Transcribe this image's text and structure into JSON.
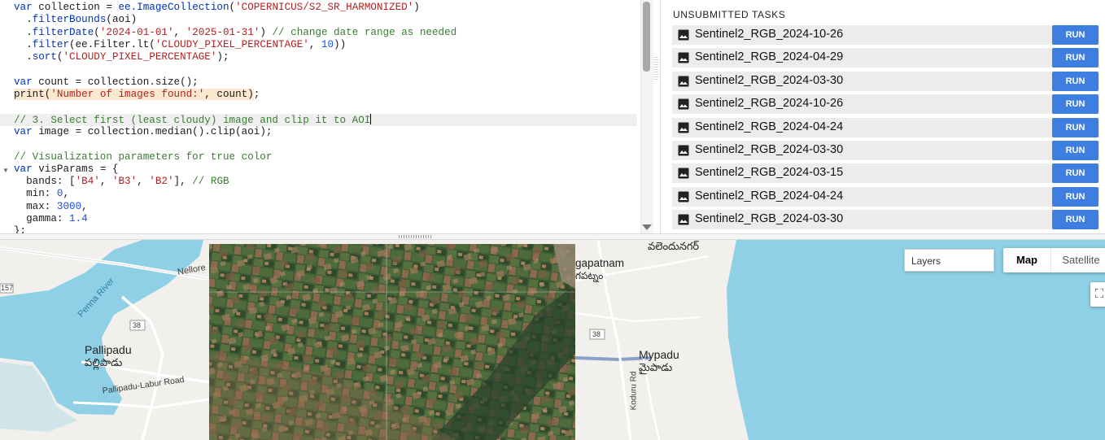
{
  "editor": {
    "lines": [
      [
        [
          "kw",
          "var"
        ],
        [
          "t",
          " collection = "
        ],
        [
          "kw",
          "ee.ImageCollection"
        ],
        [
          "t",
          "("
        ],
        [
          "str",
          "'COPERNICUS/S2_SR_HARMONIZED'"
        ],
        [
          "t",
          ")"
        ]
      ],
      [
        [
          "t",
          "  ."
        ],
        [
          "kw",
          "filterBounds"
        ],
        [
          "t",
          "(aoi)"
        ]
      ],
      [
        [
          "t",
          "  ."
        ],
        [
          "kw",
          "filterDate"
        ],
        [
          "t",
          "("
        ],
        [
          "str",
          "'2024-01-01'"
        ],
        [
          "t",
          ", "
        ],
        [
          "str",
          "'2025-01-31'"
        ],
        [
          "t",
          ") "
        ],
        [
          "cmt",
          "// change date range as needed"
        ]
      ],
      [
        [
          "t",
          "  ."
        ],
        [
          "kw",
          "filter"
        ],
        [
          "t",
          "(ee.Filter.lt("
        ],
        [
          "str",
          "'CLOUDY_PIXEL_PERCENTAGE'"
        ],
        [
          "t",
          ", "
        ],
        [
          "num",
          "10"
        ],
        [
          "t",
          "))"
        ]
      ],
      [
        [
          "t",
          "  ."
        ],
        [
          "kw",
          "sort"
        ],
        [
          "t",
          "("
        ],
        [
          "str",
          "'CLOUDY_PIXEL_PERCENTAGE'"
        ],
        [
          "t",
          ");"
        ]
      ],
      [],
      [
        [
          "kw",
          "var"
        ],
        [
          "t",
          " count = collection.size();"
        ]
      ],
      [
        [
          "hl",
          "print("
        ],
        [
          "hlstr",
          "'Number of images found:'"
        ],
        [
          "hl",
          ", count)"
        ],
        [
          "t",
          ";"
        ]
      ],
      [],
      [
        [
          "cmt",
          "// 3. Select first (least cloudy) image and clip it to AOI"
        ],
        [
          "cursor",
          ""
        ]
      ],
      [
        [
          "kw",
          "var"
        ],
        [
          "t",
          " image = collection.median().clip(aoi);"
        ]
      ],
      [],
      [
        [
          "cmt",
          "// Visualization parameters for true color"
        ]
      ],
      [
        [
          "kw",
          "var"
        ],
        [
          "t",
          " visParams = {"
        ]
      ],
      [
        [
          "t",
          "  bands: ["
        ],
        [
          "str",
          "'B4'"
        ],
        [
          "t",
          ", "
        ],
        [
          "str",
          "'B3'"
        ],
        [
          "t",
          ", "
        ],
        [
          "str",
          "'B2'"
        ],
        [
          "t",
          "], "
        ],
        [
          "cmt",
          "// RGB"
        ]
      ],
      [
        [
          "t",
          "  min: "
        ],
        [
          "num",
          "0"
        ],
        [
          "t",
          ","
        ]
      ],
      [
        [
          "t",
          "  max: "
        ],
        [
          "num",
          "3000"
        ],
        [
          "t",
          ","
        ]
      ],
      [
        [
          "t",
          "  gamma: "
        ],
        [
          "num",
          "1.4"
        ]
      ],
      [
        [
          "t",
          "};"
        ]
      ]
    ],
    "current_line_index": 9
  },
  "tasks": {
    "title": "UNSUBMITTED TASKS",
    "run_label": "RUN",
    "items": [
      {
        "name": "Sentinel2_RGB_2024-10-26"
      },
      {
        "name": "Sentinel2_RGB_2024-04-29"
      },
      {
        "name": "Sentinel2_RGB_2024-03-30"
      },
      {
        "name": "Sentinel2_RGB_2024-10-26"
      },
      {
        "name": "Sentinel2_RGB_2024-04-24"
      },
      {
        "name": "Sentinel2_RGB_2024-03-30"
      },
      {
        "name": "Sentinel2_RGB_2024-03-15"
      },
      {
        "name": "Sentinel2_RGB_2024-04-24"
      },
      {
        "name": "Sentinel2_RGB_2024-03-30"
      }
    ]
  },
  "map": {
    "layers_label": "Layers",
    "map_button": "Map",
    "satellite_button": "Satellite",
    "labels": {
      "nellore": "Nellore",
      "penna_river": "Penna River",
      "route_157": "157",
      "route_38_west": "38",
      "route_38_east": "38",
      "pallipadu": "Pallipadu",
      "pallipadu_telugu": "పల్లిపాడు",
      "pallipadu_road": "Pallipadu-Labur Road",
      "gapatnam": "gapatnam",
      "gapatnam_telugu": "గపట్నం",
      "mypadu": "Mypadu",
      "mypadu_telugu": "మైపాడు",
      "kondur": "Koduru Rd",
      "top_telugu": "వలెందునగర్"
    }
  },
  "colors": {
    "run_button": "#3d7ee0",
    "keyword": "#0033b3",
    "string": "#b22222",
    "number": "#1750eb",
    "comment": "#3a7d33",
    "water": "#8fd0e6",
    "land": "#f1f0ec"
  },
  "icons": {
    "task_icon": "image-icon",
    "fullscreen": "fullscreen-icon"
  }
}
